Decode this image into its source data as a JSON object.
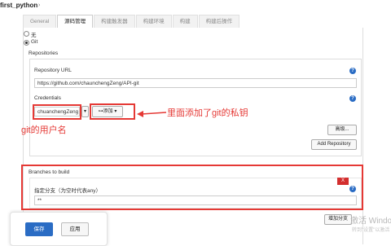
{
  "header": {
    "project": "first_python",
    "chevron_icon": "chevron-right-icon"
  },
  "tabs": [
    {
      "label": "General"
    },
    {
      "label": "源码管理"
    },
    {
      "label": "构建触发器"
    },
    {
      "label": "构建环境"
    },
    {
      "label": "构建"
    },
    {
      "label": "构建后操作"
    }
  ],
  "scm": {
    "none_label": "无",
    "git_label": "Git"
  },
  "repositories": {
    "section_label": "Repositories",
    "url_label": "Repository URL",
    "url_value": "https://github.com/chaunchengZeng/API-git",
    "credentials_label": "Credentials",
    "credentials_value": "chuanchengZeng",
    "add_label": "添加",
    "advanced_label": "高级...",
    "add_repository_label": "Add Repository"
  },
  "branches": {
    "section_label": "Branches to build",
    "spec_label": "指定分支（为空时代表any）",
    "spec_value": "**",
    "delete_label": "X",
    "add_branch_label": "增加分支"
  },
  "annotations": {
    "credentials_note": "里面添加了git的私钥",
    "username_note": "git的用户名",
    "color": "#e53935"
  },
  "actions": {
    "save_label": "保存",
    "apply_label": "应用"
  },
  "watermark": {
    "line1": "激活 Windo",
    "line2": "转到\"设置\"以激活"
  }
}
